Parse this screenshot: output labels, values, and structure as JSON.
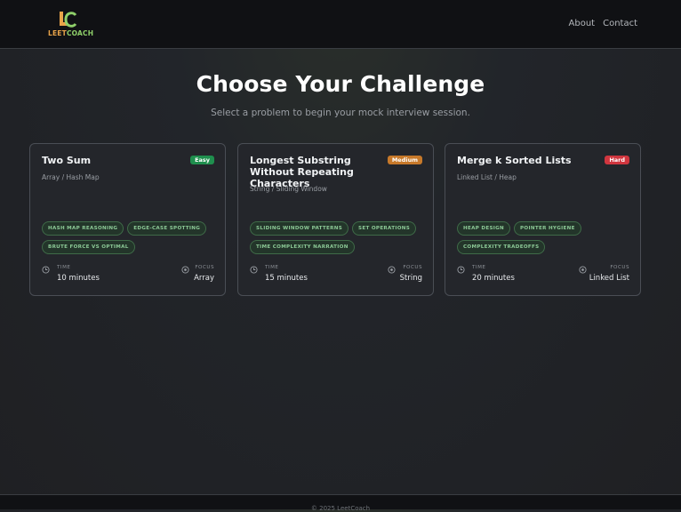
{
  "brand": {
    "part1": "LEET",
    "part2": "COACH"
  },
  "nav": {
    "about": "About",
    "contact": "Contact"
  },
  "page": {
    "title": "Choose Your Challenge",
    "subtitle": "Select a problem to begin your mock interview session."
  },
  "cards": [
    {
      "title": "Two Sum",
      "subtitle": "Array / Hash Map",
      "difficulty": "Easy",
      "difficulty_color": "#1f8f4e",
      "tags": [
        "HASH MAP REASONING",
        "EDGE-CASE SPOTTING",
        "BRUTE FORCE VS OPTIMAL"
      ],
      "time_label": "TIME",
      "time_value": "10 minutes",
      "focus_label": "FOCUS",
      "focus_value": "Array"
    },
    {
      "title": "Longest Substring Without Repeating Characters",
      "subtitle": "String / Sliding Window",
      "difficulty": "Medium",
      "difficulty_color": "#c7792a",
      "tags": [
        "SLIDING WINDOW PATTERNS",
        "SET OPERATIONS",
        "TIME COMPLEXITY NARRATION"
      ],
      "time_label": "TIME",
      "time_value": "15 minutes",
      "focus_label": "FOCUS",
      "focus_value": "String"
    },
    {
      "title": "Merge k Sorted Lists",
      "subtitle": "Linked List / Heap",
      "difficulty": "Hard",
      "difficulty_color": "#d0363f",
      "tags": [
        "HEAP DESIGN",
        "POINTER HYGIENE",
        "COMPLEXITY TRADEOFFS"
      ],
      "time_label": "TIME",
      "time_value": "20 minutes",
      "focus_label": "FOCUS",
      "focus_value": "Linked List"
    }
  ],
  "icons": {
    "time": "clock-icon",
    "focus": "target-icon"
  },
  "footer": {
    "text": "© 2025 LeetCoach"
  }
}
